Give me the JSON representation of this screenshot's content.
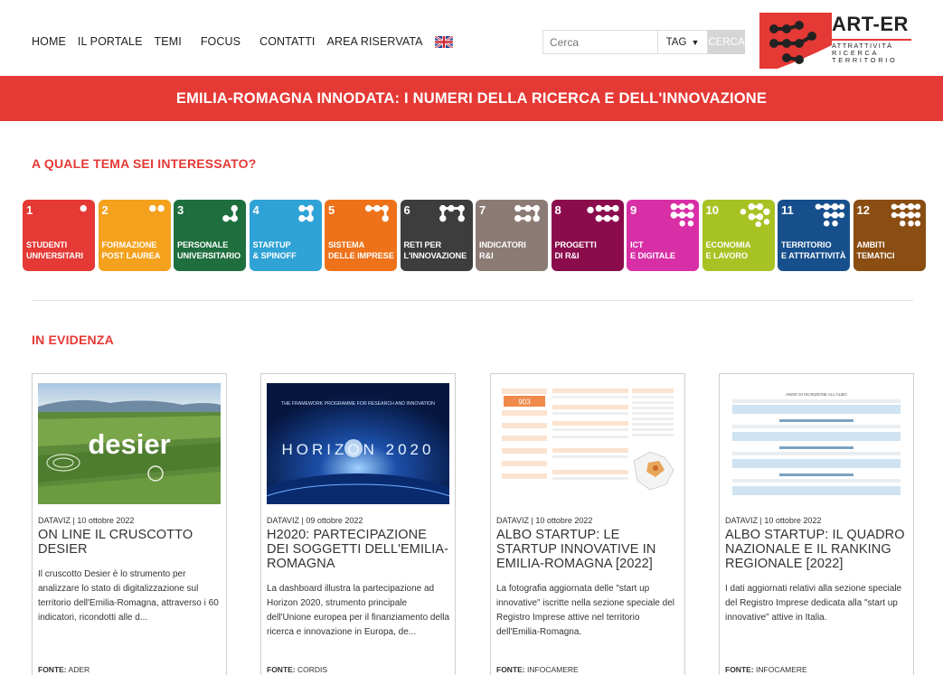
{
  "nav": {
    "items": [
      "HOME",
      "IL PORTALE",
      "TEMI",
      "FOCUS",
      "CONTATTI",
      "AREA RISERVATA"
    ],
    "flag_icon": "uk-flag-icon"
  },
  "search": {
    "placeholder": "Cerca",
    "tag_label": "TAG",
    "button_label": "CERCA"
  },
  "logo": {
    "name": "ART-ER",
    "tagline": [
      "ATTRATTIVITÀ",
      "RICERCA",
      "TERRITORIO"
    ]
  },
  "banner": {
    "title": "EMILIA-ROMAGNA INNODATA: I NUMERI DELLA RICERCA E DELL'INNOVAZIONE"
  },
  "themes_section": {
    "title": "A QUALE TEMA SEI INTERESSATO?",
    "tiles": [
      {
        "num": "1",
        "line1": "STUDENTI",
        "line2": "UNIVERSITARI",
        "color": "#e53935"
      },
      {
        "num": "2",
        "line1": "FORMAZIONE",
        "line2": "POST LAUREA",
        "color": "#f4a11d"
      },
      {
        "num": "3",
        "line1": "PERSONALE",
        "line2": "UNIVERSITARIO",
        "color": "#1e6e3e"
      },
      {
        "num": "4",
        "line1": "STARTUP",
        "line2": "& SPINOFF",
        "color": "#2fa2d6"
      },
      {
        "num": "5",
        "line1": "SISTEMA",
        "line2": "DELLE IMPRESE",
        "color": "#ee7219"
      },
      {
        "num": "6",
        "line1": "RETI PER",
        "line2": "L'INNOVAZIONE",
        "color": "#3d3d3d"
      },
      {
        "num": "7",
        "line1": "INDICATORI",
        "line2": "R&I",
        "color": "#8c7b75"
      },
      {
        "num": "8",
        "line1": "PROGETTI",
        "line2": "DI R&I",
        "color": "#8b0c4c"
      },
      {
        "num": "9",
        "line1": "ICT",
        "line2": "E DIGITALE",
        "color": "#d82fa6"
      },
      {
        "num": "10",
        "line1": "ECONOMIA",
        "line2": "E LAVORO",
        "color": "#a7c223"
      },
      {
        "num": "11",
        "line1": "TERRITORIO",
        "line2": "E ATTRATTIVITÀ",
        "color": "#174f8c"
      },
      {
        "num": "12",
        "line1": "AMBITI",
        "line2": "TEMATICI",
        "color": "#8a4d12"
      }
    ]
  },
  "featured": {
    "title": "IN EVIDENZA",
    "cards": [
      {
        "category": "DATAVIZ",
        "date": "10 ottobre 2022",
        "title": "ON LINE IL CRUSCOTTO DESIER",
        "excerpt": "Il cruscotto Desier è lo strumento per analizzare lo stato di digitalizzazione sul territorio dell'Emilia-Romagna, attraverso i 60 indicatori, ricondotti alle d...",
        "source_label": "FONTE:",
        "source": "ADER",
        "image_text": "desier"
      },
      {
        "category": "DATAVIZ",
        "date": "09 ottobre 2022",
        "title": "H2020: PARTECIPAZIONE DEI SOGGETTI DELL'EMILIA-ROMAGNA",
        "excerpt": "La dashboard illustra la partecipazione ad Horizon 2020, strumento principale dell'Unione europea per il finanziamento della ricerca e innovazione in Europa, de...",
        "source_label": "FONTE:",
        "source": "CORDIS",
        "image_caption": "THE FRAMEWORK PROGRAMME FOR RESEARCH AND INNOVATION",
        "image_text": "HORIZON 2020"
      },
      {
        "category": "DATAVIZ",
        "date": "10 ottobre 2022",
        "title": "ALBO STARTUP: LE STARTUP INNOVATIVE IN EMILIA-ROMAGNA [2022]",
        "excerpt": "La fotografia aggiornata delle \"start up innovative\" iscritte nella sezione speciale del Registro Imprese attive nel territorio dell'Emilia-Romagna.",
        "source_label": "FONTE:",
        "source": "INFOCAMERE",
        "image_text": "903"
      },
      {
        "category": "DATAVIZ",
        "date": "10 ottobre 2022",
        "title": "ALBO STARTUP: IL QUADRO NAZIONALE E IL RANKING REGIONALE [2022]",
        "excerpt": "I dati aggiornati relativi alla sezione speciale del Registro Imprese dedicata alla \"start up innovative\" attive in Italia.",
        "source_label": "FONTE:",
        "source": "INFOCAMERE",
        "image_text": "ANNO DI ISCRIZIONE ALL'ALBO"
      }
    ]
  }
}
